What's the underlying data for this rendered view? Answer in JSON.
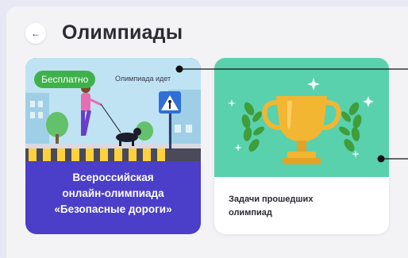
{
  "header": {
    "back_icon": "arrow-left-icon",
    "title": "Олимпиады"
  },
  "cards": [
    {
      "badge": "Бесплатно",
      "status": "Олимпиада идет",
      "title_lines": [
        "Всероссийская",
        "онлайн-олимпиада",
        "«Безопасные дороги»"
      ],
      "illustration": "pedestrian-crossing-illustration"
    },
    {
      "title_lines": [
        "Задачи прошедших",
        "олимпиад"
      ],
      "illustration": "trophy-illustration"
    }
  ],
  "colors": {
    "accent_purple": "#4b3ec9",
    "badge_green": "#3fb14a",
    "trophy_bg": "#5ad1ad"
  }
}
